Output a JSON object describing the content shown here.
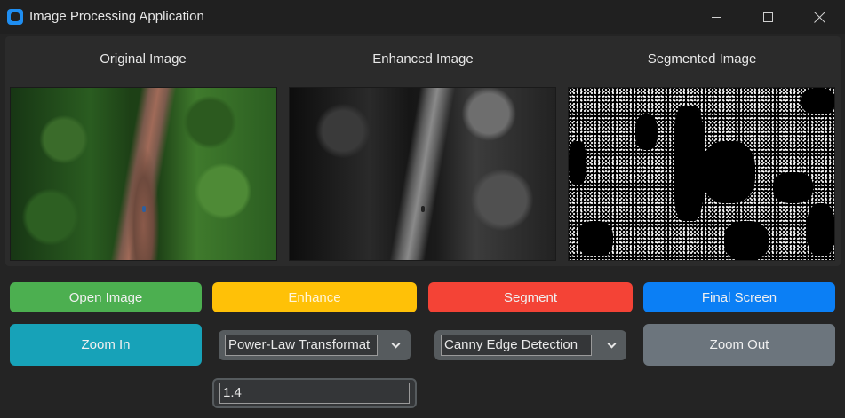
{
  "window": {
    "title": "Image Processing Application",
    "icon": "app-icon"
  },
  "panels": {
    "original_label": "Original Image",
    "enhanced_label": "Enhanced Image",
    "segmented_label": "Segmented Image"
  },
  "buttons": {
    "open_image": "Open Image",
    "enhance": "Enhance",
    "segment": "Segment",
    "final_screen": "Final Screen",
    "zoom_in": "Zoom In",
    "zoom_out": "Zoom Out"
  },
  "controls": {
    "enhance_method": "Power-Law Transformat",
    "segment_method": "Canny Edge Detection",
    "gamma_value": "1.4"
  },
  "colors": {
    "open_image": "#4caf50",
    "enhance": "#ffc107",
    "segment": "#f44336",
    "final_screen": "#0b7ff5",
    "zoom_in": "#17a2b8",
    "zoom_out": "#6c757d"
  }
}
